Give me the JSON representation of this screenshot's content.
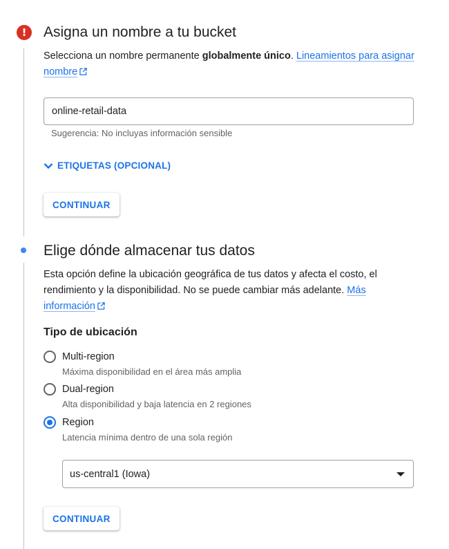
{
  "step1": {
    "title": "Asigna un nombre a tu bucket",
    "desc_prefix": "Selecciona un nombre permanente ",
    "desc_bold": "globalmente único",
    "desc_suffix": ". ",
    "link_text": "Lineamientos para asignar nombre",
    "input_value": "online-retail-data",
    "hint": "Sugerencia: No incluyas información sensible",
    "labels_toggle": "ETIQUETAS (OPCIONAL)",
    "continue_label": "CONTINUAR",
    "status_icon": "error-icon",
    "status_color": "#d93025"
  },
  "step2": {
    "title": "Elige dónde almacenar tus datos",
    "desc": "Esta opción define la ubicación geográfica de tus datos y afecta el costo, el rendimiento y la disponibilidad. No se puede cambiar más adelante. ",
    "link_text": "Más información",
    "location_type_title": "Tipo de ubicación",
    "options": [
      {
        "label": "Multi-region",
        "desc": "Máxima disponibilidad en el área más amplia",
        "selected": false
      },
      {
        "label": "Dual-region",
        "desc": "Alta disponibilidad y baja latencia en 2 regiones",
        "selected": false
      },
      {
        "label": "Region",
        "desc": "Latencia mínima dentro de una sola región",
        "selected": true
      }
    ],
    "region_select": "us-central1 (Iowa)",
    "continue_label": "CONTINUAR",
    "accent_color": "#1a73e8"
  }
}
